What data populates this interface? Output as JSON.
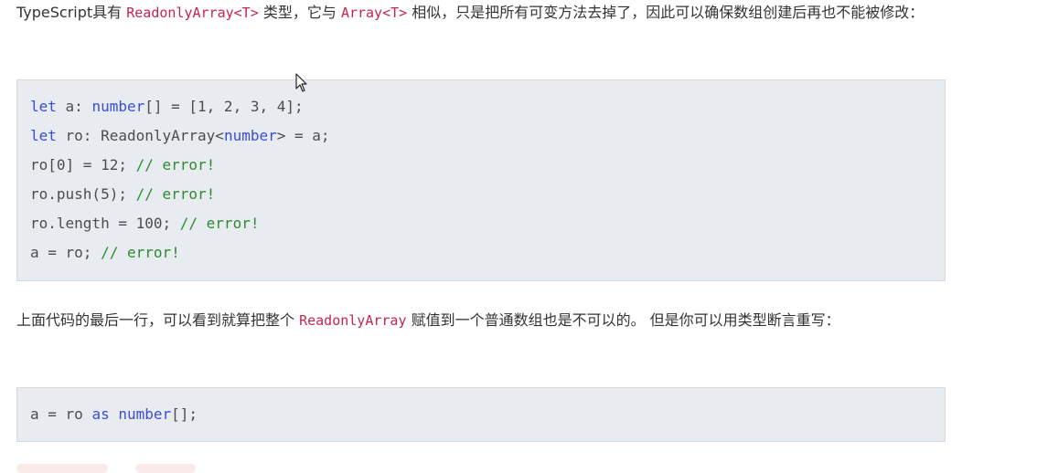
{
  "para1": {
    "t1": "TypeScript具有 ",
    "c1": "ReadonlyArray<T>",
    "t2": " 类型，它与 ",
    "c2": "Array<T>",
    "t3": " 相似，只是把所有可变方法去掉了，因此可以确保数组创建后再也不能被修改："
  },
  "code1": [
    [
      {
        "t": "let",
        "k": "kw"
      },
      {
        "t": " a: "
      },
      {
        "t": "number",
        "k": "kw"
      },
      {
        "t": "[] = [1, 2, 3, 4];"
      }
    ],
    [
      {
        "t": "let",
        "k": "kw"
      },
      {
        "t": " ro: ReadonlyArray<"
      },
      {
        "t": "number",
        "k": "kw"
      },
      {
        "t": "> = a;"
      }
    ],
    [
      {
        "t": "ro[0] = 12; "
      },
      {
        "t": "// error!",
        "k": "cm"
      }
    ],
    [
      {
        "t": "ro.push(5); "
      },
      {
        "t": "// error!",
        "k": "cm"
      }
    ],
    [
      {
        "t": "ro.length = 100; "
      },
      {
        "t": "// error!",
        "k": "cm"
      }
    ],
    [
      {
        "t": "a = ro; "
      },
      {
        "t": "// error!",
        "k": "cm"
      }
    ]
  ],
  "para2": {
    "t1": "上面代码的最后一行，可以看到就算把整个 ",
    "c1": "ReadonlyArray",
    "t2": " 赋值到一个普通数组也是不可以的。 但是你可以用类型断言重写："
  },
  "code2": [
    [
      {
        "t": "a = ro "
      },
      {
        "t": "as",
        "k": "kw"
      },
      {
        "t": " "
      },
      {
        "t": "number",
        "k": "kw"
      },
      {
        "t": "[];"
      }
    ]
  ],
  "colors": {
    "text": "#333333",
    "inline_code": "#c7254e",
    "code_bg": "#e8ebf0",
    "keyword": "#3a4ddb",
    "comment": "#2e8b2e"
  }
}
